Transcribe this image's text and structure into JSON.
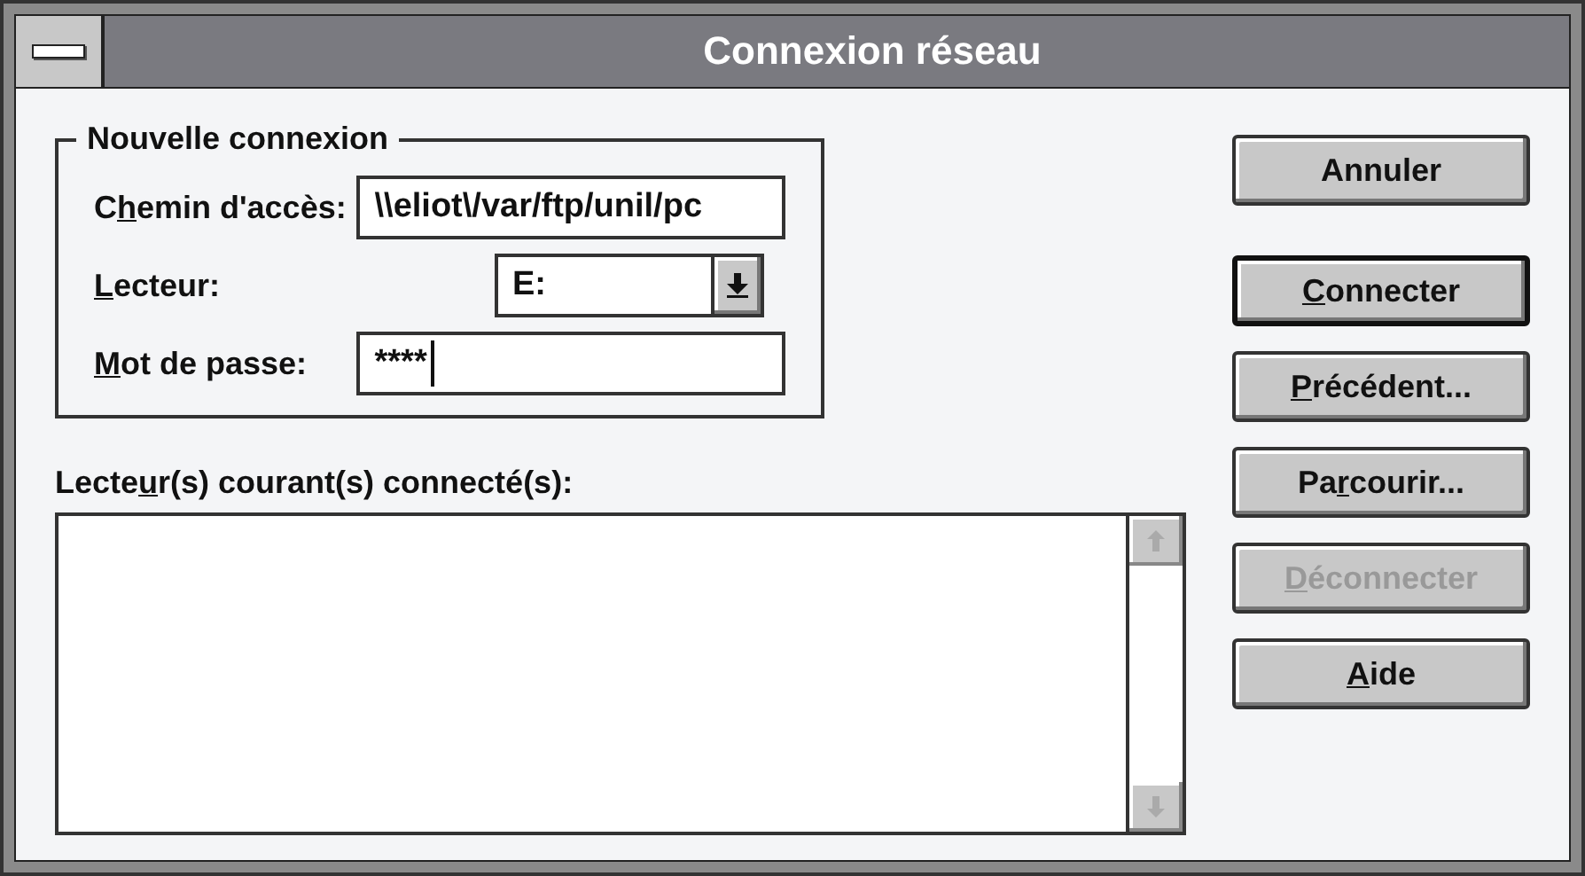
{
  "window": {
    "title": "Connexion réseau"
  },
  "group": {
    "title": "Nouvelle connexion",
    "fields": [
      {
        "kind": "text",
        "label_pre": "C",
        "access_key": "h",
        "label_post": "emin d'accès:",
        "value": "\\\\eliot\\/var/ftp/unil/pc",
        "focused": false
      },
      {
        "kind": "dropdown",
        "access_key": "L",
        "label_post": "ecteur:",
        "value": "E:",
        "focused": false
      },
      {
        "kind": "text",
        "access_key": "M",
        "label_post": "ot de passe:",
        "value": "****",
        "focused": true
      }
    ]
  },
  "list": {
    "label_pre": "Lecte",
    "access_key": "u",
    "label_post": "r(s) courant(s) connecté(s):"
  },
  "buttons": [
    {
      "label_post": "Annuler",
      "default": false,
      "disabled": false
    },
    {
      "access_key": "C",
      "label_post": "onnecter",
      "default": true,
      "disabled": false
    },
    {
      "access_key": "P",
      "label_post": "récédent...",
      "default": false,
      "disabled": false
    },
    {
      "label_pre": "Pa",
      "access_key": "r",
      "label_post": "courir...",
      "default": false,
      "disabled": false
    },
    {
      "access_key": "D",
      "label_post": "éconnecter",
      "default": false,
      "disabled": true
    },
    {
      "access_key": "A",
      "label_post": "ide",
      "default": false,
      "disabled": false
    }
  ]
}
